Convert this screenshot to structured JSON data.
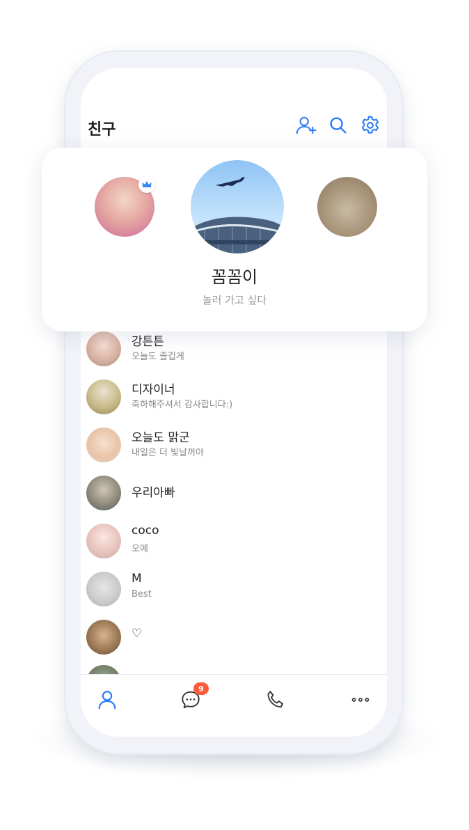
{
  "header": {
    "title": "친구"
  },
  "profile_card": {
    "name": "꼼꼼이",
    "status": "놀러 가고 싶다"
  },
  "friends": [
    {
      "name": "강튼튼",
      "status": "오늘도 즐겁게"
    },
    {
      "name": "디자이너",
      "status": "축하해주셔서 감사합니다:)"
    },
    {
      "name": "오늘도 맑군",
      "status": "내일은 더 빛날꺼야"
    },
    {
      "name": "우리아빠",
      "status": ""
    },
    {
      "name": "coco",
      "status": "오예"
    },
    {
      "name": "M",
      "status": "Best"
    },
    {
      "name": "♡",
      "status": ""
    }
  ],
  "tabbar": {
    "chat_badge": "9",
    "tabs": [
      "friends-icon",
      "chat-icon",
      "phone-icon",
      "more-icon"
    ]
  },
  "colors": {
    "accent": "#2f7df6",
    "badge": "#ff5a3c",
    "icon_dark": "#333333"
  }
}
